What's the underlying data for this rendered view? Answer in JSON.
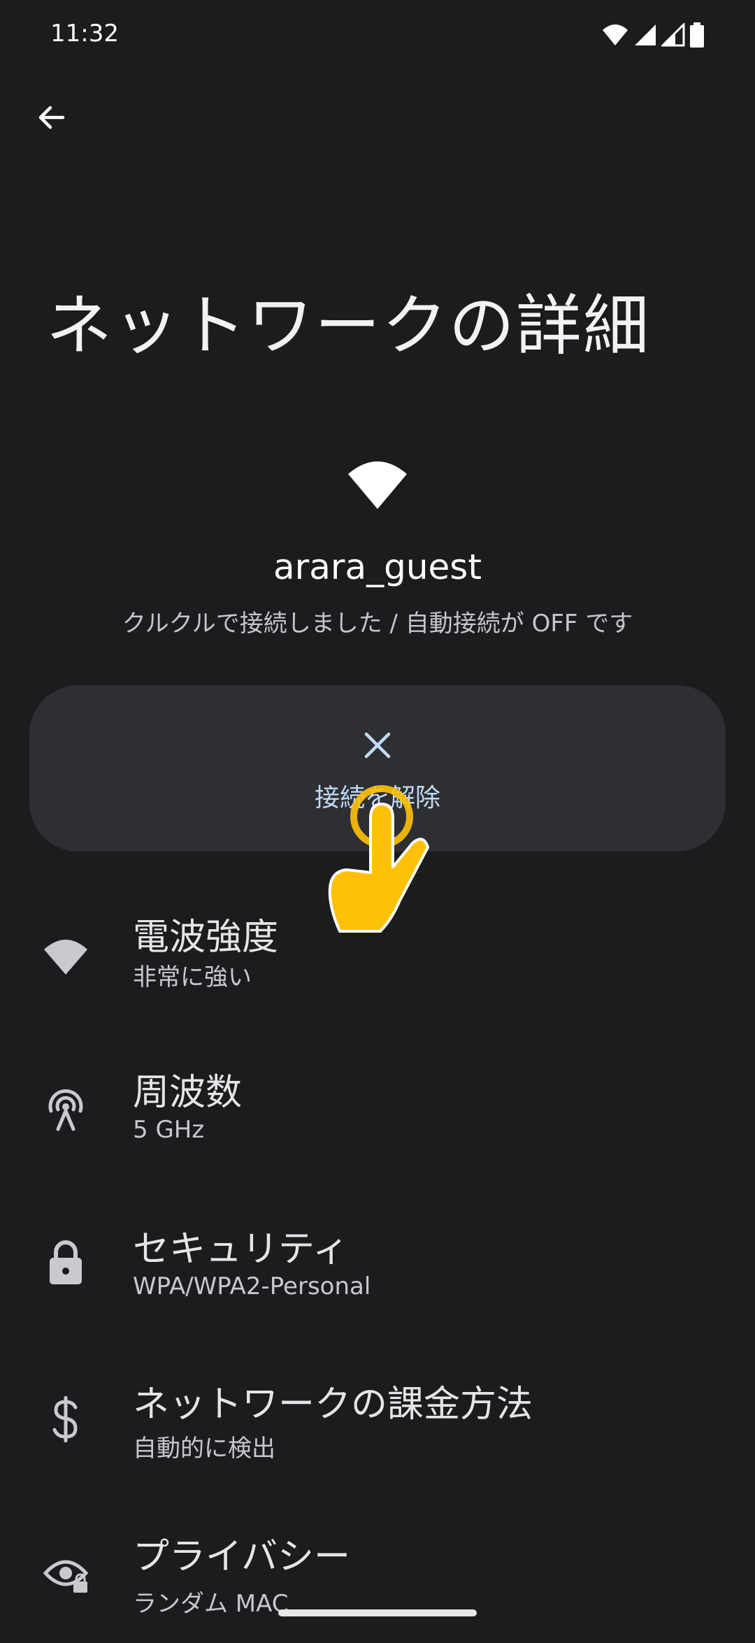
{
  "status_bar": {
    "time": "11:32"
  },
  "header": {
    "back_icon": "arrow-back-icon",
    "title": "ネットワークの詳細"
  },
  "network": {
    "icon": "wifi-icon",
    "name": "arara_guest",
    "status": "クルクルで接続しました / 自動接続が OFF です"
  },
  "disconnect": {
    "icon": "close-icon",
    "label": "接続を解除"
  },
  "details": [
    {
      "icon": "wifi-signal-icon",
      "title": "電波強度",
      "value": "非常に強い"
    },
    {
      "icon": "frequency-icon",
      "title": "周波数",
      "value": "5 GHz"
    },
    {
      "icon": "lock-icon",
      "title": "セキュリティ",
      "value": "WPA/WPA2-Personal"
    },
    {
      "icon": "dollar-icon",
      "title": "ネットワークの課金方法",
      "value": "自動的に検出"
    },
    {
      "icon": "privacy-eye-icon",
      "title": "プライバシー",
      "value": "ランダム MAC"
    }
  ],
  "colors": {
    "background": "#1b1c1e",
    "button_bg": "#2e2f32",
    "accent": "#c2dbf5",
    "hand": "#ffc107"
  }
}
